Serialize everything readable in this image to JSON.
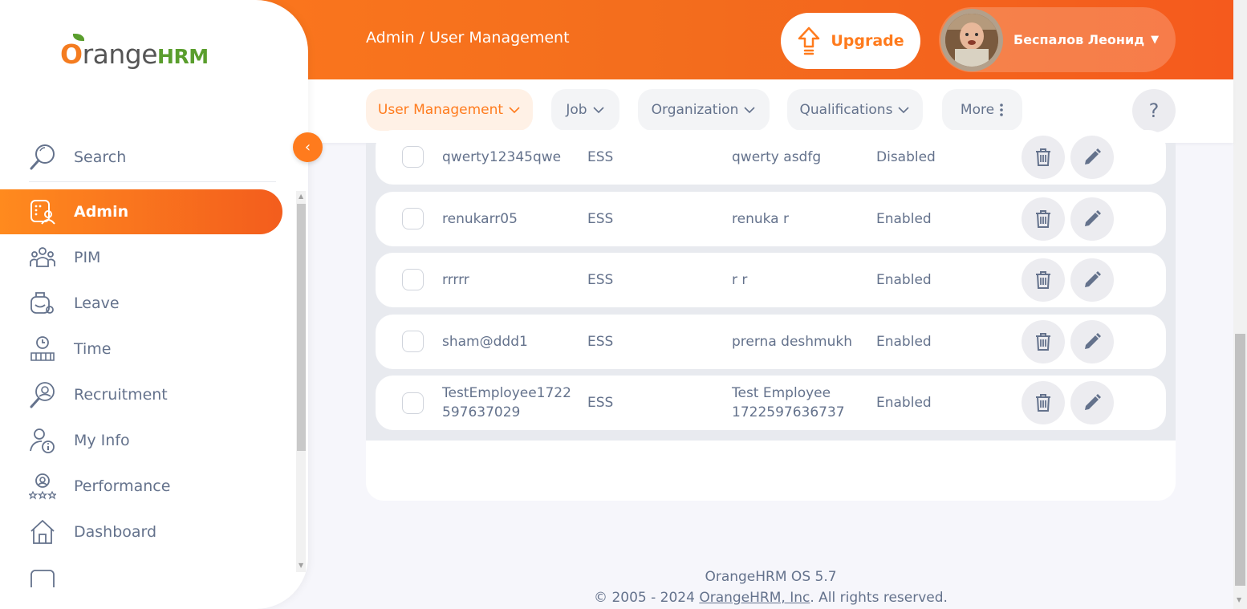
{
  "header": {
    "breadcrumb": "Admin / User Management",
    "upgrade_label": "Upgrade",
    "user_name": "Беспалов Леонид",
    "user_caret": "▼"
  },
  "topnav": {
    "items": [
      {
        "label": "User Management",
        "icon": "chevron-down-icon"
      },
      {
        "label": "Job",
        "icon": "chevron-down-icon"
      },
      {
        "label": "Organization",
        "icon": "chevron-down-icon"
      },
      {
        "label": "Qualifications",
        "icon": "chevron-down-icon"
      },
      {
        "label": "More",
        "icon": "more-vertical-icon"
      }
    ],
    "help_label": "?"
  },
  "sidebar": {
    "logo_text": "range",
    "logo_hrm": "HRM",
    "search_label": "Search",
    "collapse_icon": "‹",
    "items": [
      {
        "label": "Admin",
        "icon": "admin-icon",
        "active": true
      },
      {
        "label": "PIM",
        "icon": "pim-icon"
      },
      {
        "label": "Leave",
        "icon": "leave-icon"
      },
      {
        "label": "Time",
        "icon": "time-icon"
      },
      {
        "label": "Recruitment",
        "icon": "recruitment-icon"
      },
      {
        "label": "My Info",
        "icon": "my-info-icon"
      },
      {
        "label": "Performance",
        "icon": "performance-icon"
      },
      {
        "label": "Dashboard",
        "icon": "dashboard-icon"
      }
    ]
  },
  "table": {
    "rows": [
      {
        "username": "qwerty12345qwe",
        "role": "ESS",
        "employee": "qwerty asdfg",
        "status": "Disabled"
      },
      {
        "username": "renukarr05",
        "role": "ESS",
        "employee": "renuka r",
        "status": "Enabled"
      },
      {
        "username": "rrrrr",
        "role": "ESS",
        "employee": "r r",
        "status": "Enabled"
      },
      {
        "username": "sham@ddd1",
        "role": "ESS",
        "employee": "prerna deshmukh",
        "status": "Enabled"
      },
      {
        "username": "TestEmployee1722597637029",
        "username_line1": "TestEmployee1722",
        "username_line2": "597637029",
        "role": "ESS",
        "employee": "Test Employee 1722597636737",
        "employee_line1": "Test Employee",
        "employee_line2": "1722597636737",
        "status": "Enabled"
      }
    ]
  },
  "footer": {
    "version": "OrangeHRM OS 5.7",
    "copyright_prefix": "© 2005 - 2024 ",
    "company_link": "OrangeHRM, Inc",
    "copyright_suffix": ". All rights reserved."
  },
  "colors": {
    "accent": "#ff7b1d",
    "text": "#64728c",
    "logo_green": "#5a9e2d"
  }
}
